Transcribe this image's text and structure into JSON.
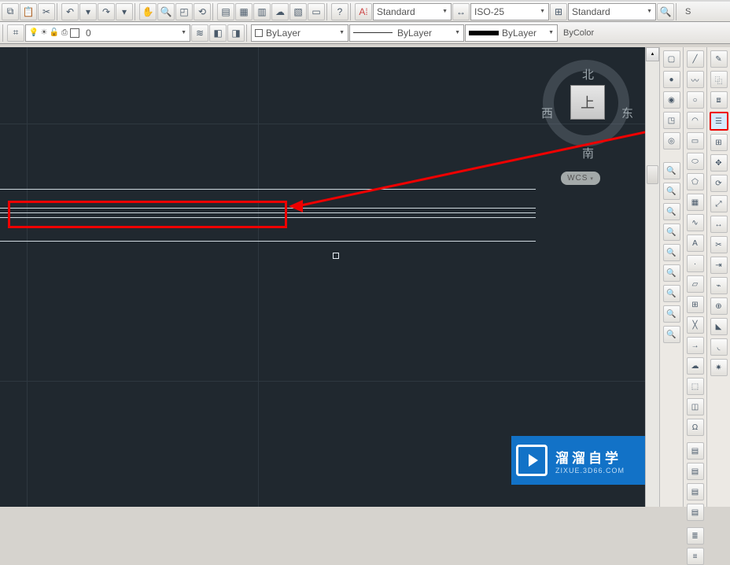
{
  "top_row1": {
    "buttons": [
      "copy",
      "paste",
      "match",
      "undo",
      "redo",
      "undo-dd",
      "redo-dd",
      "pan",
      "zoom-win",
      "zoom-ext",
      "zoom-rt",
      "tile-h",
      "tile-v",
      "cascade",
      "arrange",
      "props",
      "drawset",
      "layer-mgr",
      "text-tool",
      "calc",
      "help"
    ],
    "style_dropdown": "Standard",
    "dim_tool": "dim-tool",
    "dim_dropdown": "ISO-25",
    "table_tool": "table-tool",
    "table_dropdown": "Standard",
    "autoscale_btn": "autoscale",
    "trailing_text": "S"
  },
  "top_row2": {
    "filter_tool": "layer-filter",
    "layer_dropdown_label": "0",
    "layer_btns": [
      "prev-layer",
      "layer-iso",
      "layer-tool"
    ],
    "color_dropdown": "ByLayer",
    "ltype_dropdown": "ByLayer",
    "lweight_dropdown": "ByLayer",
    "plot_style": "ByColor"
  },
  "viewcube": {
    "north": "北",
    "south": "南",
    "east": "东",
    "west": "西",
    "face": "上",
    "wcs": "WCS"
  },
  "watermark": {
    "title": "溜溜自学",
    "sub": "ZIXUE.3D66.COM"
  },
  "palettes": {
    "col1": [
      "3d-box",
      "3d-sphere",
      "3d-sphere2",
      "ucs-icon",
      "toggle-btn",
      "zoom-center",
      "zoom-scale",
      "zoom-sel",
      "zoom-ext2",
      "zoom-prev",
      "zoom-all",
      "zoom-obj",
      "zoom-win2",
      "zoom-dyn",
      "zoom-real",
      "blank"
    ],
    "col2": [
      "wire-on",
      "plines-off",
      "isolines",
      "mesh",
      "shade",
      "render",
      "tess",
      "smooth",
      "grid",
      "3dface",
      "poly",
      "rsurf",
      "facets",
      "delobj",
      "revsurf",
      "tabsurf",
      "msurf",
      "hideline",
      "planar",
      "region",
      "presspull"
    ],
    "col3": [
      "mirror",
      "offset",
      "array",
      "move",
      "rotate",
      "trim",
      "extend",
      "fillet",
      "chamfer",
      "stretch",
      "scale",
      "lengthen",
      "break",
      "join",
      "explode",
      "align",
      "edgeoffset",
      "shell",
      "solidedit",
      "imprint",
      "unify"
    ],
    "col4_bottom": [
      "layers-a",
      "layers-b",
      "layers-c",
      "layers-d",
      "layers-e",
      "layers-f"
    ]
  },
  "annotations": {
    "highlight_target": "press-pull-icon"
  }
}
